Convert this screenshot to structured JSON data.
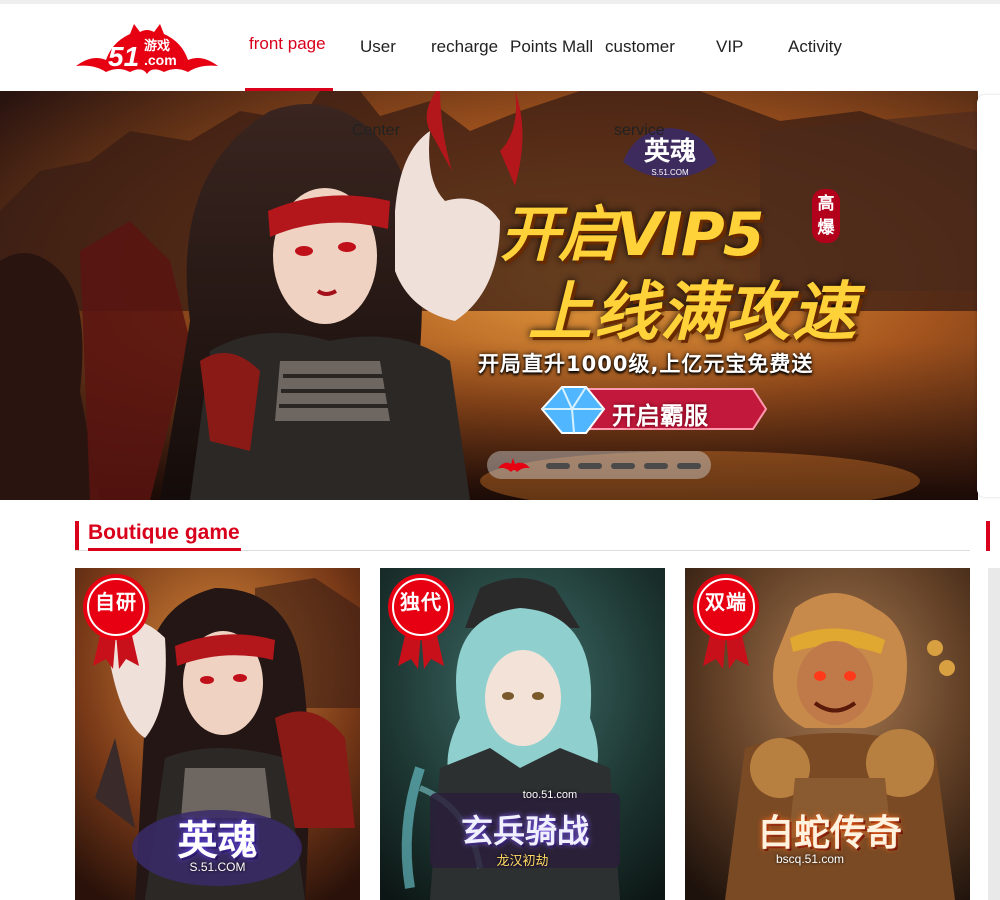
{
  "brand": {
    "logo_text": "51",
    "logo_sub": "游戏",
    "logo_domain": ".com",
    "color": "#d9001b"
  },
  "nav": {
    "front_page": "front page",
    "user": "User",
    "user_wrap": "Center",
    "recharge": "recharge",
    "points_mall": "Points Mall",
    "customer": "customer",
    "customer_wrap": "service",
    "vip": "VIP",
    "activity": "Activity"
  },
  "banner": {
    "game_logo": "英魂",
    "game_domain": "S.51.COM",
    "headline_line1": "开启VIP5",
    "headline_line2": "上线满攻速",
    "tag": "高爆",
    "subtitle": "开局直升1000级,上亿元宝免费送",
    "cta": "开启霸服",
    "slide_count": 6,
    "active_slide": 1
  },
  "section": {
    "title": "Boutique game"
  },
  "games": [
    {
      "badge": "自研",
      "logo": "英魂",
      "sub": "S.51.COM"
    },
    {
      "badge": "独代",
      "logo": "玄兵骑战",
      "sub": "龙汉初劫",
      "domain": "too.51.com"
    },
    {
      "badge": "双端",
      "logo": "白蛇传奇",
      "sub": "bscq.51.com"
    }
  ]
}
